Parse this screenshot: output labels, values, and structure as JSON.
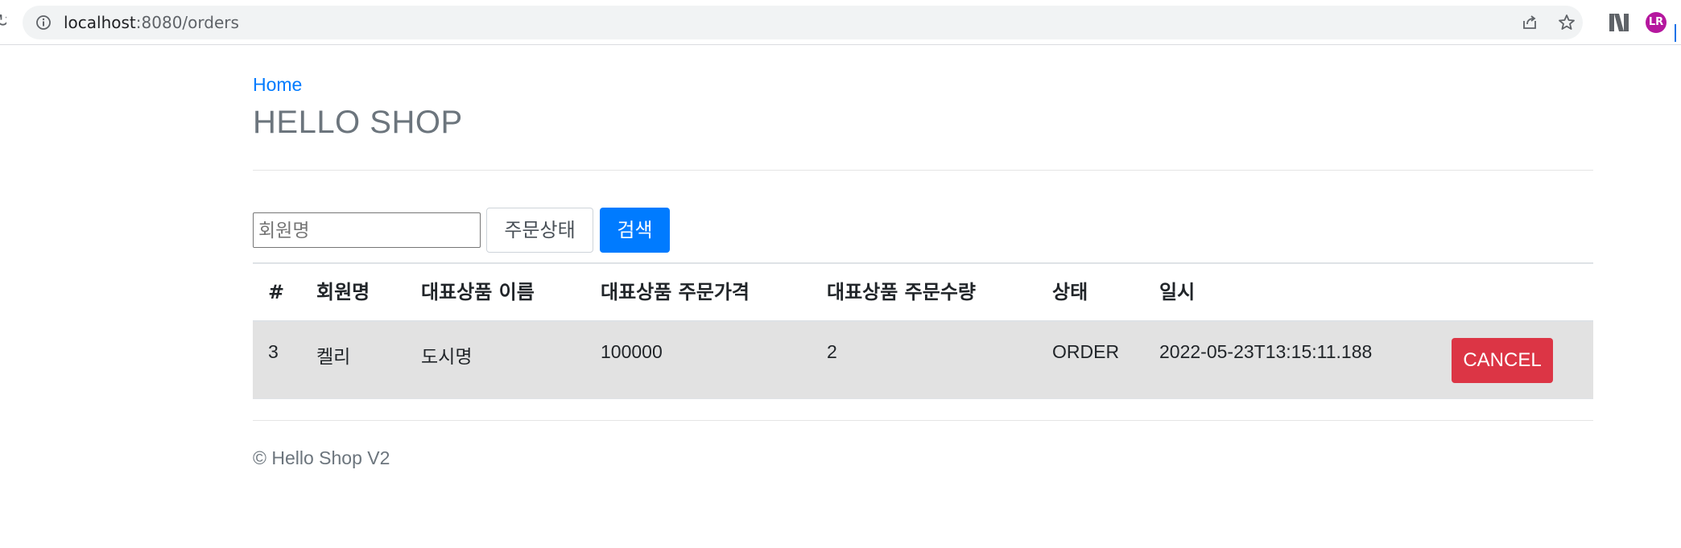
{
  "browser": {
    "url_host": "localhost",
    "url_path": ":8080/orders",
    "profile_initials": "LR",
    "icons": [
      "info-icon",
      "share-icon",
      "star-icon",
      "extension-icon",
      "profile-icon"
    ]
  },
  "nav": {
    "home_label": "Home"
  },
  "header": {
    "title": "HELLO SHOP"
  },
  "search": {
    "member_placeholder": "회원명",
    "status_label": "주문상태",
    "submit_label": "검색"
  },
  "table": {
    "headers": [
      "#",
      "회원명",
      "대표상품 이름",
      "대표상품 주문가격",
      "대표상품 주문수량",
      "상태",
      "일시"
    ],
    "rows": [
      {
        "id": "3",
        "member": "켈리",
        "item_name": "도시명",
        "price": "100000",
        "count": "2",
        "status": "ORDER",
        "date": "2022-05-23T13:15:11.188",
        "action_label": "CANCEL"
      }
    ]
  },
  "footer": {
    "text": "© Hello Shop V2"
  },
  "colors": {
    "primary": "#007bff",
    "danger": "#dc3545",
    "row_highlight": "#e2e2e2",
    "muted": "#6c757d"
  }
}
